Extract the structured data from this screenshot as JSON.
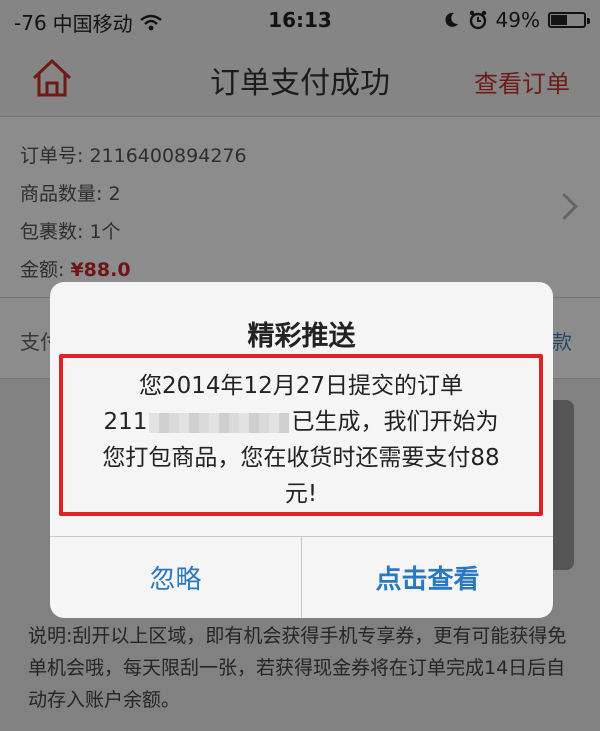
{
  "status_bar": {
    "signal": "-76",
    "carrier": "中国移动",
    "time": "16:13",
    "battery_percent": "49%",
    "battery_level": 0.49
  },
  "nav": {
    "title": "订单支付成功",
    "right_action": "查看订单",
    "accent_color": "#c8322b"
  },
  "order": {
    "order_no": "订单号: 2116400894276",
    "item_count": "商品数量: 2",
    "package_count": "包裹数: 1个",
    "amount_label": "金额:",
    "amount_value": "¥88.0"
  },
  "payment_row": {
    "left_text": "支付",
    "right_text": "款"
  },
  "note": "说明:刮开以上区域，即有机会获得手机专享券，更有可能获得免单机会哦，每天限刮一张，若获得现金券将在订单完成14日后自动存入账户余额。",
  "alert": {
    "title": "精彩推送",
    "message_line1": "您2014年12月27日提交的订单",
    "message_prefix": "211",
    "message_line2_suffix": "已生成，我们开始为",
    "message_line3": "您打包商品，您在收货时还需要支付88",
    "message_line4": "元!",
    "button_ignore": "忽略",
    "button_view": "点击查看",
    "highlight_color": "#e32024",
    "button_color": "#2a79c0"
  },
  "icons": {
    "home": "home-icon",
    "wifi": "wifi-icon",
    "moon": "moon-icon",
    "alarm": "alarm-icon",
    "battery": "battery-icon",
    "chevron": "chevron-right-icon"
  }
}
